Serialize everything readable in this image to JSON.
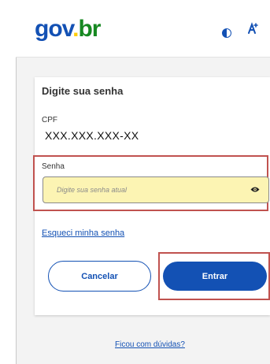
{
  "header": {
    "logo": {
      "part1": "gov",
      "dot": ".",
      "part2": "br"
    },
    "contrast_icon": "contrast-icon",
    "language_icon": "language-icon"
  },
  "login": {
    "title": "Digite sua senha",
    "cpf_label": "CPF",
    "cpf_value": "XXX.XXX.XXX-XX",
    "password_label": "Senha",
    "password_placeholder": "Digite sua senha atual",
    "password_value": "",
    "forgot_link": "Esqueci minha senha",
    "cancel_label": "Cancelar",
    "enter_label": "Entrar"
  },
  "footer": {
    "help_link": "Ficou com dúvidas?"
  },
  "colors": {
    "brand_blue": "#1351b4",
    "brand_yellow": "#ffcd07",
    "brand_green": "#168821",
    "input_background": "#fcf4b3",
    "highlight_border": "#c0524f"
  }
}
